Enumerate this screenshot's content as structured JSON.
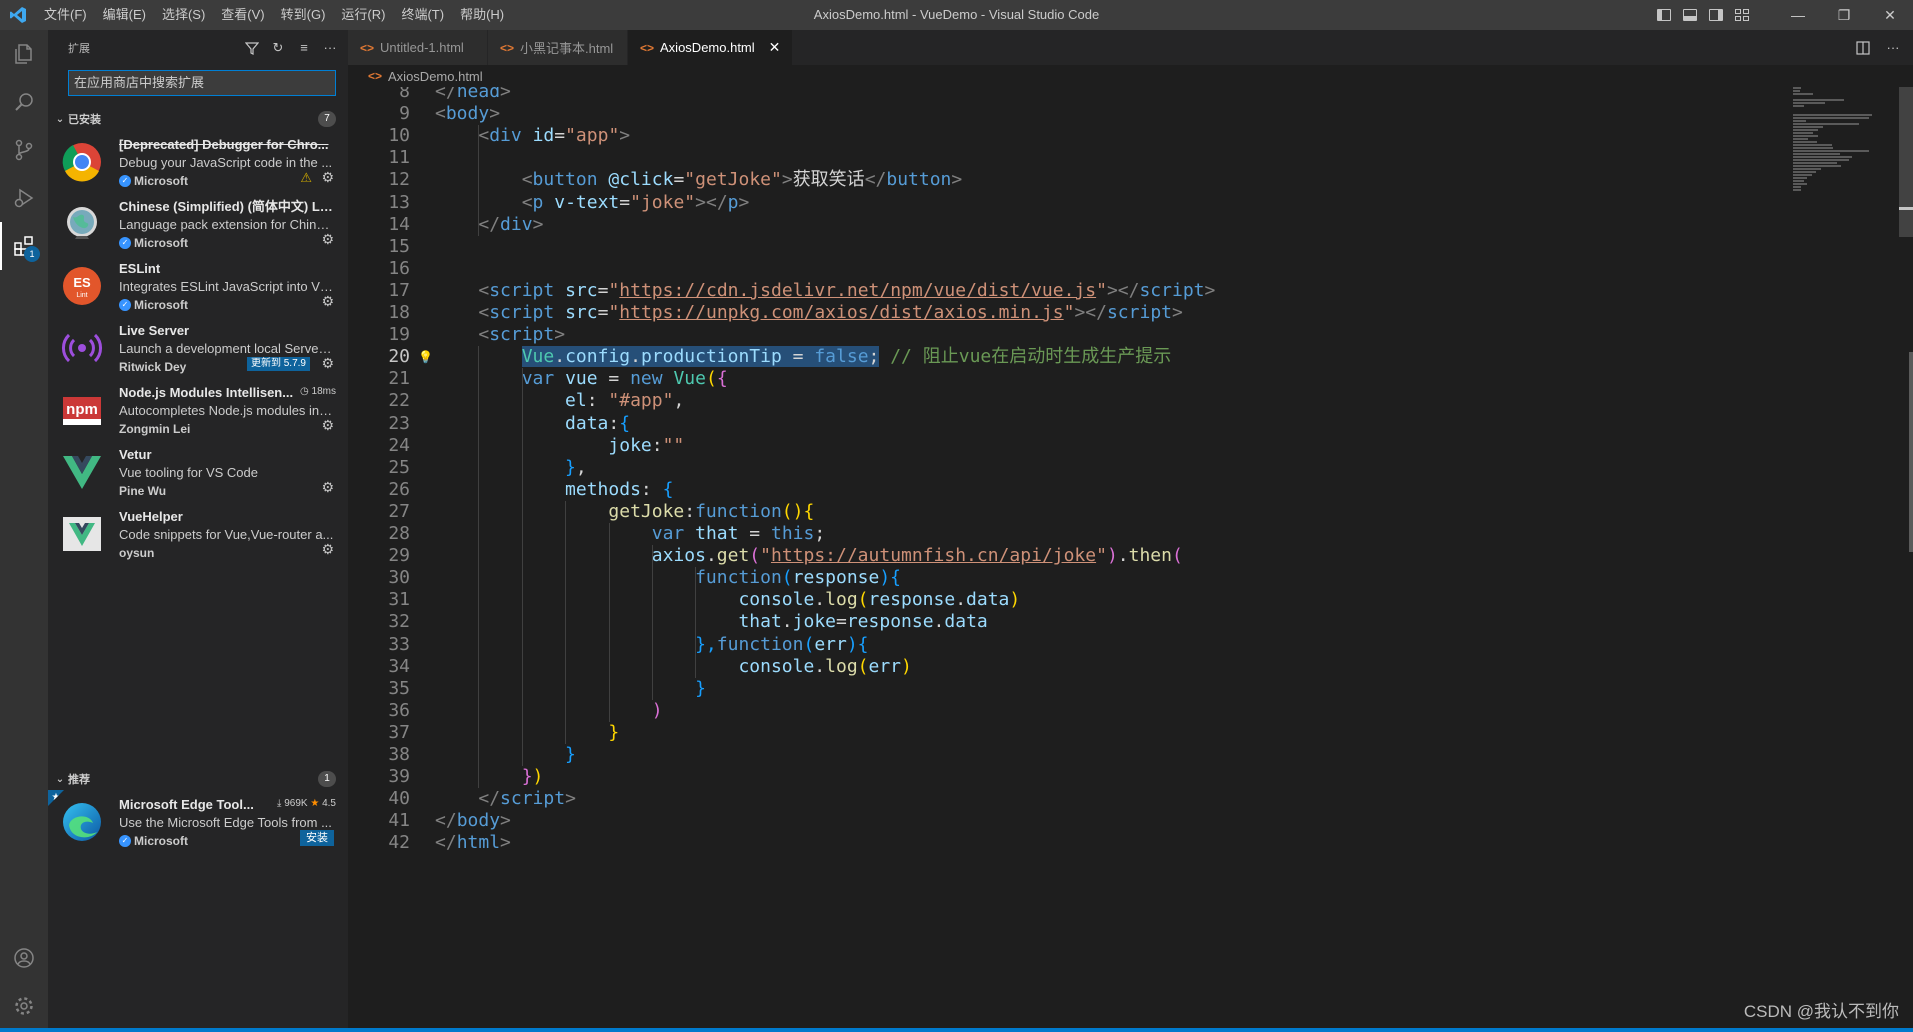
{
  "window": {
    "title": "AxiosDemo.html - VueDemo - Visual Studio Code",
    "logo": "vscode-logo",
    "menus": [
      "文件(F)",
      "编辑(E)",
      "选择(S)",
      "查看(V)",
      "转到(G)",
      "运行(R)",
      "终端(T)",
      "帮助(H)"
    ],
    "controls": {
      "minimize": "—",
      "restore": "❐",
      "close": "✕"
    }
  },
  "activity_bar": {
    "items": [
      "explorer-icon",
      "search-icon",
      "source-control-icon",
      "run-debug-icon",
      "extensions-icon"
    ],
    "extensions_badge": "1",
    "bottom": [
      "account-icon",
      "settings-gear-icon"
    ]
  },
  "sidebar": {
    "title": "扩展",
    "search_placeholder": "在应用商店中搜索扩展",
    "installed": {
      "label": "已安装",
      "count": "7",
      "items": [
        {
          "name": "[Deprecated] Debugger for Chro...",
          "desc": "Debug your JavaScript code in the ...",
          "publisher": "Microsoft",
          "verified": true,
          "icon": "chrome-icon",
          "deprecated": true,
          "warning": true
        },
        {
          "name": "Chinese (Simplified) (简体中文) La...",
          "desc": "Language pack extension for Chines...",
          "publisher": "Microsoft",
          "verified": true,
          "icon": "globe-icon"
        },
        {
          "name": "ESLint",
          "desc": "Integrates ESLint JavaScript into VS ...",
          "publisher": "Microsoft",
          "verified": true,
          "icon": "eslint-icon"
        },
        {
          "name": "Live Server",
          "desc": "Launch a development local Server ...",
          "publisher": "Ritwick Dey",
          "verified": false,
          "icon": "live-server-icon",
          "update": "更新到 5.7.9"
        },
        {
          "name": "Node.js Modules Intellisen...",
          "desc": "Autocompletes Node.js modules in i...",
          "publisher": "Zongmin Lei",
          "verified": false,
          "icon": "npm-icon",
          "meta": "18ms"
        },
        {
          "name": "Vetur",
          "desc": "Vue tooling for VS Code",
          "publisher": "Pine Wu",
          "verified": false,
          "icon": "vetur-icon"
        },
        {
          "name": "VueHelper",
          "desc": "Code snippets for Vue,Vue-router a...",
          "publisher": "oysun",
          "verified": false,
          "icon": "vuehelper-icon"
        }
      ]
    },
    "recommended": {
      "label": "推荐",
      "count": "1",
      "items": [
        {
          "name": "Microsoft Edge Tool...",
          "desc": "Use the Microsoft Edge Tools from ...",
          "publisher": "Microsoft",
          "verified": true,
          "icon": "edge-icon",
          "downloads": "969K",
          "rating": "4.5",
          "install": "安装"
        }
      ]
    }
  },
  "editor": {
    "tabs": [
      {
        "label": "Untitled-1.html",
        "active": false
      },
      {
        "label": "小黑记事本.html",
        "active": false
      },
      {
        "label": "AxiosDemo.html",
        "active": true
      }
    ],
    "breadcrumb": "AxiosDemo.html",
    "current_line": 20,
    "lines": [
      {
        "n": "8",
        "tokens": [
          [
            "t-br",
            "</"
          ],
          [
            "t-tag",
            "head"
          ],
          [
            "t-br",
            ">"
          ]
        ]
      },
      {
        "n": "9",
        "tokens": [
          [
            "t-br",
            "<"
          ],
          [
            "t-tag",
            "body"
          ],
          [
            "t-br",
            ">"
          ]
        ]
      },
      {
        "n": "10",
        "tokens": [
          [
            "t-pl",
            "    "
          ],
          [
            "t-br",
            "<"
          ],
          [
            "t-tag",
            "div"
          ],
          [
            "t-pl",
            " "
          ],
          [
            "t-attr",
            "id"
          ],
          [
            "t-pl",
            "="
          ],
          [
            "t-str",
            "\"app\""
          ],
          [
            "t-br",
            ">"
          ]
        ]
      },
      {
        "n": "11",
        "tokens": []
      },
      {
        "n": "12",
        "tokens": [
          [
            "t-pl",
            "        "
          ],
          [
            "t-br",
            "<"
          ],
          [
            "t-tag",
            "button"
          ],
          [
            "t-pl",
            " "
          ],
          [
            "t-attr",
            "@click"
          ],
          [
            "t-pl",
            "="
          ],
          [
            "t-str",
            "\"getJoke\""
          ],
          [
            "t-br",
            ">"
          ],
          [
            "t-pl",
            "获取笑话"
          ],
          [
            "t-br",
            "</"
          ],
          [
            "t-tag",
            "button"
          ],
          [
            "t-br",
            ">"
          ]
        ]
      },
      {
        "n": "13",
        "tokens": [
          [
            "t-pl",
            "        "
          ],
          [
            "t-br",
            "<"
          ],
          [
            "t-tag",
            "p"
          ],
          [
            "t-pl",
            " "
          ],
          [
            "t-attr",
            "v-text"
          ],
          [
            "t-pl",
            "="
          ],
          [
            "t-str",
            "\"joke\""
          ],
          [
            "t-br",
            "></"
          ],
          [
            "t-tag",
            "p"
          ],
          [
            "t-br",
            ">"
          ]
        ]
      },
      {
        "n": "14",
        "tokens": [
          [
            "t-pl",
            "    "
          ],
          [
            "t-br",
            "</"
          ],
          [
            "t-tag",
            "div"
          ],
          [
            "t-br",
            ">"
          ]
        ]
      },
      {
        "n": "15",
        "tokens": []
      },
      {
        "n": "16",
        "tokens": []
      },
      {
        "n": "17",
        "tokens": [
          [
            "t-pl",
            "    "
          ],
          [
            "t-br",
            "<"
          ],
          [
            "t-tag",
            "script"
          ],
          [
            "t-pl",
            " "
          ],
          [
            "t-attr",
            "src"
          ],
          [
            "t-pl",
            "="
          ],
          [
            "t-str",
            "\""
          ],
          [
            "t-str t-ul",
            "https://cdn.jsdelivr.net/npm/vue/dist/vue.js"
          ],
          [
            "t-str",
            "\""
          ],
          [
            "t-br",
            "></"
          ],
          [
            "t-tag",
            "script"
          ],
          [
            "t-br",
            ">"
          ]
        ]
      },
      {
        "n": "18",
        "tokens": [
          [
            "t-pl",
            "    "
          ],
          [
            "t-br",
            "<"
          ],
          [
            "t-tag",
            "script"
          ],
          [
            "t-pl",
            " "
          ],
          [
            "t-attr",
            "src"
          ],
          [
            "t-pl",
            "="
          ],
          [
            "t-str",
            "\""
          ],
          [
            "t-str t-ul",
            "https://unpkg.com/axios/dist/axios.min.js"
          ],
          [
            "t-str",
            "\""
          ],
          [
            "t-br",
            "></"
          ],
          [
            "t-tag",
            "script"
          ],
          [
            "t-br",
            ">"
          ]
        ]
      },
      {
        "n": "19",
        "tokens": [
          [
            "t-pl",
            "    "
          ],
          [
            "t-br",
            "<"
          ],
          [
            "t-tag",
            "script"
          ],
          [
            "t-br",
            ">"
          ]
        ]
      },
      {
        "n": "20",
        "tokens": [
          [
            "t-pl",
            "        "
          ],
          [
            "t-cls sel",
            "Vue"
          ],
          [
            "t-pl sel",
            "."
          ],
          [
            "t-var sel",
            "config"
          ],
          [
            "t-pl sel",
            "."
          ],
          [
            "t-var sel",
            "productionTip"
          ],
          [
            "t-pl sel",
            " = "
          ],
          [
            "t-kw sel",
            "false"
          ],
          [
            "t-pl sel",
            ";"
          ],
          [
            "t-pl",
            " "
          ],
          [
            "t-com",
            "// 阻止vue在启动时生成生产提示"
          ]
        ]
      },
      {
        "n": "21",
        "tokens": [
          [
            "t-pl",
            "        "
          ],
          [
            "t-kw",
            "var"
          ],
          [
            "t-pl",
            " "
          ],
          [
            "t-var",
            "vue"
          ],
          [
            "t-pl",
            " = "
          ],
          [
            "t-kw",
            "new"
          ],
          [
            "t-pl",
            " "
          ],
          [
            "t-cls",
            "Vue"
          ],
          [
            "t-p1",
            "("
          ],
          [
            "t-p2",
            "{"
          ]
        ]
      },
      {
        "n": "22",
        "tokens": [
          [
            "t-pl",
            "            "
          ],
          [
            "t-var",
            "el"
          ],
          [
            "t-pl",
            ": "
          ],
          [
            "t-str",
            "\"#app\""
          ],
          [
            "t-pl",
            ","
          ]
        ]
      },
      {
        "n": "23",
        "tokens": [
          [
            "t-pl",
            "            "
          ],
          [
            "t-var",
            "data"
          ],
          [
            "t-pl",
            ":"
          ],
          [
            "t-p3",
            "{"
          ]
        ]
      },
      {
        "n": "24",
        "tokens": [
          [
            "t-pl",
            "                "
          ],
          [
            "t-var",
            "joke"
          ],
          [
            "t-pl",
            ":"
          ],
          [
            "t-str",
            "\"\""
          ]
        ]
      },
      {
        "n": "25",
        "tokens": [
          [
            "t-pl",
            "            "
          ],
          [
            "t-p3",
            "}"
          ],
          [
            "t-pl",
            ","
          ]
        ]
      },
      {
        "n": "26",
        "tokens": [
          [
            "t-pl",
            "            "
          ],
          [
            "t-var",
            "methods"
          ],
          [
            "t-pl",
            ": "
          ],
          [
            "t-p3",
            "{"
          ]
        ]
      },
      {
        "n": "27",
        "tokens": [
          [
            "t-pl",
            "                "
          ],
          [
            "t-fn",
            "getJoke"
          ],
          [
            "t-pl",
            ":"
          ],
          [
            "t-kw",
            "function"
          ],
          [
            "t-p1",
            "(){"
          ]
        ]
      },
      {
        "n": "28",
        "tokens": [
          [
            "t-pl",
            "                    "
          ],
          [
            "t-kw",
            "var"
          ],
          [
            "t-pl",
            " "
          ],
          [
            "t-var",
            "that"
          ],
          [
            "t-pl",
            " = "
          ],
          [
            "t-kw",
            "this"
          ],
          [
            "t-pl",
            ";"
          ]
        ]
      },
      {
        "n": "29",
        "tokens": [
          [
            "t-pl",
            "                    "
          ],
          [
            "t-var",
            "axios"
          ],
          [
            "t-pl",
            "."
          ],
          [
            "t-fn",
            "get"
          ],
          [
            "t-p2",
            "("
          ],
          [
            "t-str",
            "\""
          ],
          [
            "t-str t-ul",
            "https://autumnfish.cn/api/joke"
          ],
          [
            "t-str",
            "\""
          ],
          [
            "t-p2",
            ")"
          ],
          [
            "t-pl",
            "."
          ],
          [
            "t-fn",
            "then"
          ],
          [
            "t-p2",
            "("
          ]
        ]
      },
      {
        "n": "30",
        "tokens": [
          [
            "t-pl",
            "                        "
          ],
          [
            "t-kw",
            "function"
          ],
          [
            "t-p3",
            "("
          ],
          [
            "t-var",
            "response"
          ],
          [
            "t-p3",
            "){"
          ]
        ]
      },
      {
        "n": "31",
        "tokens": [
          [
            "t-pl",
            "                            "
          ],
          [
            "t-var",
            "console"
          ],
          [
            "t-pl",
            "."
          ],
          [
            "t-fn",
            "log"
          ],
          [
            "t-p1",
            "("
          ],
          [
            "t-var",
            "response"
          ],
          [
            "t-pl",
            "."
          ],
          [
            "t-var",
            "data"
          ],
          [
            "t-p1",
            ")"
          ]
        ]
      },
      {
        "n": "32",
        "tokens": [
          [
            "t-pl",
            "                            "
          ],
          [
            "t-var",
            "that"
          ],
          [
            "t-pl",
            "."
          ],
          [
            "t-var",
            "joke"
          ],
          [
            "t-pl",
            "="
          ],
          [
            "t-var",
            "response"
          ],
          [
            "t-pl",
            "."
          ],
          [
            "t-var",
            "data"
          ]
        ]
      },
      {
        "n": "33",
        "tokens": [
          [
            "t-pl",
            "                        "
          ],
          [
            "t-p3",
            "},"
          ],
          [
            "t-kw",
            "function"
          ],
          [
            "t-p3",
            "("
          ],
          [
            "t-var",
            "err"
          ],
          [
            "t-p3",
            "){"
          ]
        ]
      },
      {
        "n": "34",
        "tokens": [
          [
            "t-pl",
            "                            "
          ],
          [
            "t-var",
            "console"
          ],
          [
            "t-pl",
            "."
          ],
          [
            "t-fn",
            "log"
          ],
          [
            "t-p1",
            "("
          ],
          [
            "t-var",
            "err"
          ],
          [
            "t-p1",
            ")"
          ]
        ]
      },
      {
        "n": "35",
        "tokens": [
          [
            "t-pl",
            "                        "
          ],
          [
            "t-p3",
            "}"
          ]
        ]
      },
      {
        "n": "36",
        "tokens": [
          [
            "t-pl",
            "                    "
          ],
          [
            "t-p2",
            ")"
          ]
        ]
      },
      {
        "n": "37",
        "tokens": [
          [
            "t-pl",
            "                "
          ],
          [
            "t-p1",
            "}"
          ]
        ]
      },
      {
        "n": "38",
        "tokens": [
          [
            "t-pl",
            "            "
          ],
          [
            "t-p3",
            "}"
          ]
        ]
      },
      {
        "n": "39",
        "tokens": [
          [
            "t-pl",
            "        "
          ],
          [
            "t-p2",
            "}"
          ],
          [
            "t-p1",
            ")"
          ]
        ]
      },
      {
        "n": "40",
        "tokens": [
          [
            "t-pl",
            "    "
          ],
          [
            "t-br",
            "</"
          ],
          [
            "t-tag",
            "script"
          ],
          [
            "t-br",
            ">"
          ]
        ]
      },
      {
        "n": "41",
        "tokens": [
          [
            "t-br",
            "</"
          ],
          [
            "t-tag",
            "body"
          ],
          [
            "t-br",
            ">"
          ]
        ]
      },
      {
        "n": "42",
        "tokens": [
          [
            "t-br",
            "</"
          ],
          [
            "t-tag",
            "html"
          ],
          [
            "t-br",
            ">"
          ]
        ]
      }
    ]
  },
  "watermark": "CSDN @我认不到你",
  "colors": {
    "accent": "#007acc",
    "activity_bar": "#333333",
    "sidebar": "#252526",
    "editor": "#1e1e1e"
  }
}
